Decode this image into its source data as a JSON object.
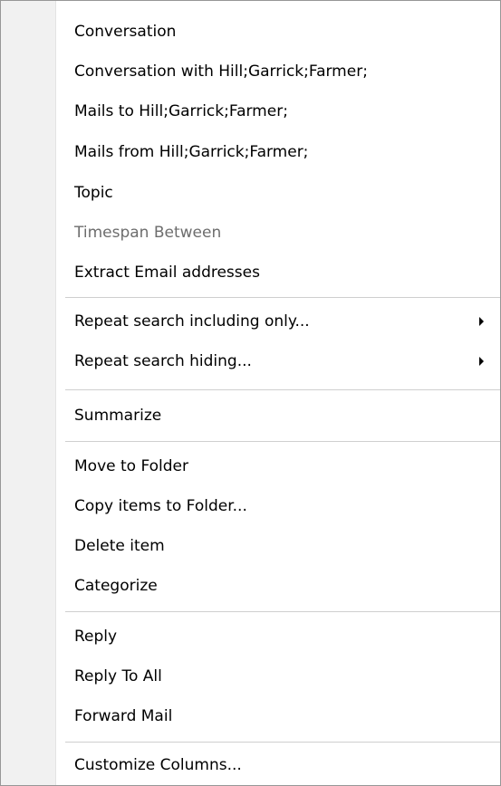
{
  "menu": {
    "conversation": "Conversation",
    "conversation_with": "Conversation with Hill;Garrick;Farmer;",
    "mails_to": "Mails to Hill;Garrick;Farmer;",
    "mails_from": "Mails from Hill;Garrick;Farmer;",
    "topic": "Topic",
    "timespan_between": "Timespan Between",
    "extract_email": "Extract Email addresses",
    "repeat_including": "Repeat search including only...",
    "repeat_hiding": "Repeat search hiding...",
    "summarize": "Summarize",
    "move_to_folder": "Move to Folder",
    "copy_items": "Copy items to Folder...",
    "delete_item": "Delete item",
    "categorize": "Categorize",
    "reply": "Reply",
    "reply_to_all": "Reply To All",
    "forward_mail": "Forward Mail",
    "customize_columns": "Customize Columns..."
  },
  "colors": {
    "border": "#979797",
    "gutter": "#f1f1f1",
    "separator": "#cfcfcf",
    "disabled_text": "#6d6d6d"
  },
  "icons": {
    "submenu": "submenu-arrow-icon"
  }
}
